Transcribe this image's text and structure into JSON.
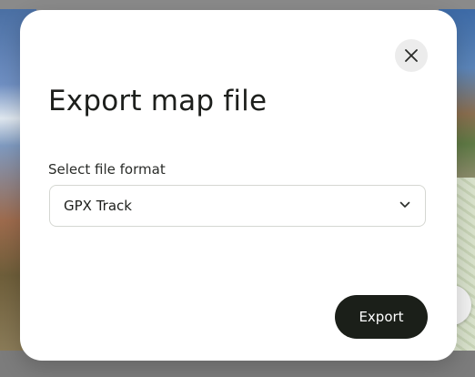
{
  "modal": {
    "title": "Export map file",
    "close_icon": "close-icon",
    "format_field": {
      "label": "Select file format",
      "selected_value": "GPX Track",
      "icon": "chevron-down-icon"
    },
    "export_button": {
      "label": "Export"
    }
  },
  "colors": {
    "modal_background": "#ffffff",
    "primary_button": "#1b1f19",
    "close_button_background": "#ececec",
    "text_primary": "#1d1f1c"
  }
}
